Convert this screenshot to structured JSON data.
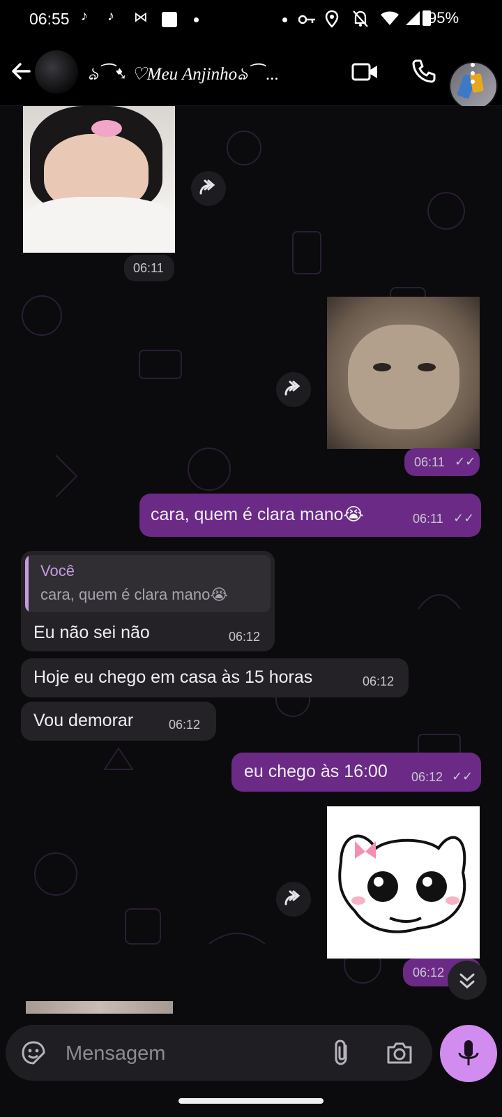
{
  "status_bar": {
    "time": "06:55",
    "battery": "95%",
    "left_icons": [
      "tiktok-icon",
      "tiktok-icon",
      "capcut-icon",
      "square-icon",
      "dot-icon"
    ],
    "right_icons": [
      "dot-icon",
      "key-icon",
      "location-icon",
      "bell-off-icon",
      "wifi-icon",
      "signal-icon",
      "battery-icon"
    ]
  },
  "header": {
    "contact_name": "ঌ⁀➷ ♡Meu Anjinhoঌ⁀ ...",
    "icons": [
      "back-arrow-icon",
      "video-call-icon",
      "phone-icon",
      "more-vert-icon"
    ]
  },
  "messages": [
    {
      "type": "image",
      "direction": "in",
      "time": "06:11",
      "image": "photo of person lying on pillow with pink bow"
    },
    {
      "type": "image",
      "direction": "out",
      "time": "06:11",
      "image": "grumpy cat photo"
    },
    {
      "type": "text",
      "direction": "out",
      "text": "cara, quem é clara mano😭",
      "time": "06:11"
    },
    {
      "type": "reply",
      "direction": "in",
      "quote_author": "Você",
      "quote_text": "cara, quem é clara mano😭",
      "text": "Eu não sei não",
      "time": "06:12"
    },
    {
      "type": "text",
      "direction": "in",
      "text": "Hoje eu chego em casa às 15 horas",
      "time": "06:12"
    },
    {
      "type": "text",
      "direction": "in",
      "text": "Vou demorar",
      "time": "06:12"
    },
    {
      "type": "text",
      "direction": "out",
      "text": "eu chego às 16:00",
      "time": "06:12"
    },
    {
      "type": "image",
      "direction": "out",
      "time": "06:12",
      "image": "hello kitty doodle sticker"
    }
  ],
  "composer": {
    "placeholder": "Mensagem"
  },
  "colors": {
    "outgoing_bubble": "#6b2a86",
    "incoming_bubble": "#242226",
    "mic_button": "#d28cf0",
    "quote_bar": "#c79be0"
  }
}
